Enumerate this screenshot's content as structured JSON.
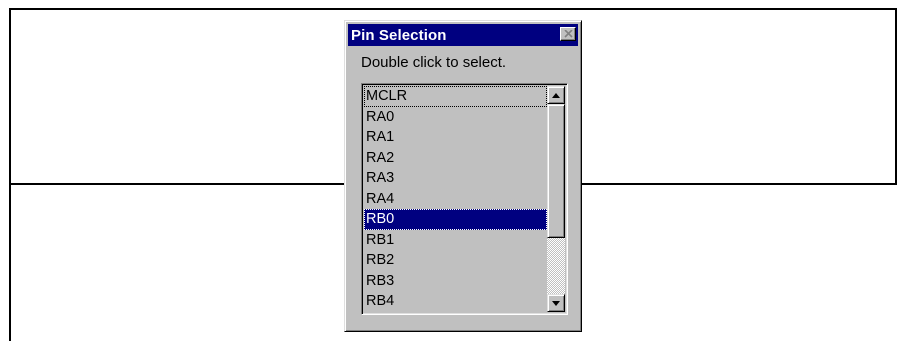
{
  "window": {
    "title": "Pin Selection",
    "close_icon": "close-icon"
  },
  "instruction": "Double click to select.",
  "listbox": {
    "items": [
      {
        "label": "MCLR",
        "state": "focused"
      },
      {
        "label": "RA0",
        "state": ""
      },
      {
        "label": "RA1",
        "state": ""
      },
      {
        "label": "RA2",
        "state": ""
      },
      {
        "label": "RA3",
        "state": ""
      },
      {
        "label": "RA4",
        "state": ""
      },
      {
        "label": "RB0",
        "state": "selected"
      },
      {
        "label": "RB1",
        "state": ""
      },
      {
        "label": "RB2",
        "state": ""
      },
      {
        "label": "RB3",
        "state": ""
      },
      {
        "label": "RB4",
        "state": ""
      }
    ],
    "selected_label": "RB0",
    "scroll_up_icon": "arrow-up-icon",
    "scroll_down_icon": "arrow-down-icon"
  },
  "colors": {
    "titlebar": "#000080",
    "selection": "#000080",
    "face": "#c0c0c0"
  }
}
